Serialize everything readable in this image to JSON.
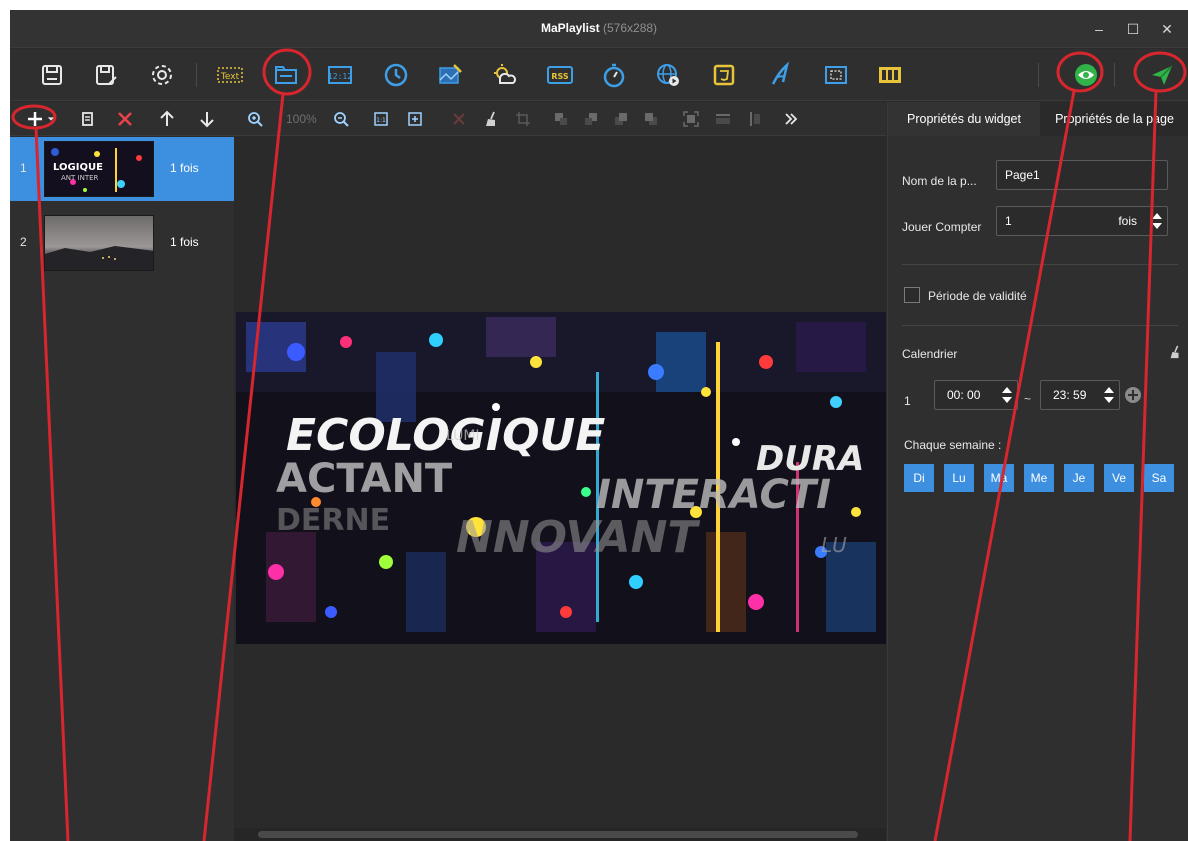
{
  "window": {
    "title": "MaPlaylist",
    "resolution": "(576x288)",
    "controls": {
      "minimize": "–",
      "maximize": "☐",
      "close": "✕"
    }
  },
  "toolbar": {
    "text_tool_label": "Text",
    "clock_tool_label": "12:12",
    "rss_tool_label": "RSS"
  },
  "canvas_toolbar": {
    "zoom_level": "100%"
  },
  "pages": [
    {
      "number": "1",
      "count": "1 fois",
      "selected": true
    },
    {
      "number": "2",
      "count": "1 fois",
      "selected": false
    }
  ],
  "preview": {
    "words": [
      "ECOLOGIQUE",
      "DURA",
      "ACTANT",
      "INTERACTI",
      "NNOVANT",
      "DERNE",
      "LUMI",
      "LU"
    ]
  },
  "right_panel": {
    "tabs": [
      "Propriétés du widget",
      "Propriétés de la page"
    ],
    "page_name_label": "Nom de la p...",
    "page_name_value": "Page1",
    "play_count_label": "Jouer Compter",
    "play_count_value": "1",
    "play_count_unit": "fois",
    "validity_label": "Période de validité",
    "calendar_label": "Calendrier",
    "schedule": [
      {
        "index": "1",
        "start": "00: 00",
        "end": "23: 59"
      }
    ],
    "schedule_separator": "~",
    "weekly_label": "Chaque semaine :",
    "days": [
      "Di",
      "Lu",
      "Ma",
      "Me",
      "Je",
      "Ve",
      "Sa"
    ]
  },
  "colors": {
    "accent": "#3d8fe0",
    "annotation": "#d8262e",
    "panel": "#2f2f2f"
  }
}
